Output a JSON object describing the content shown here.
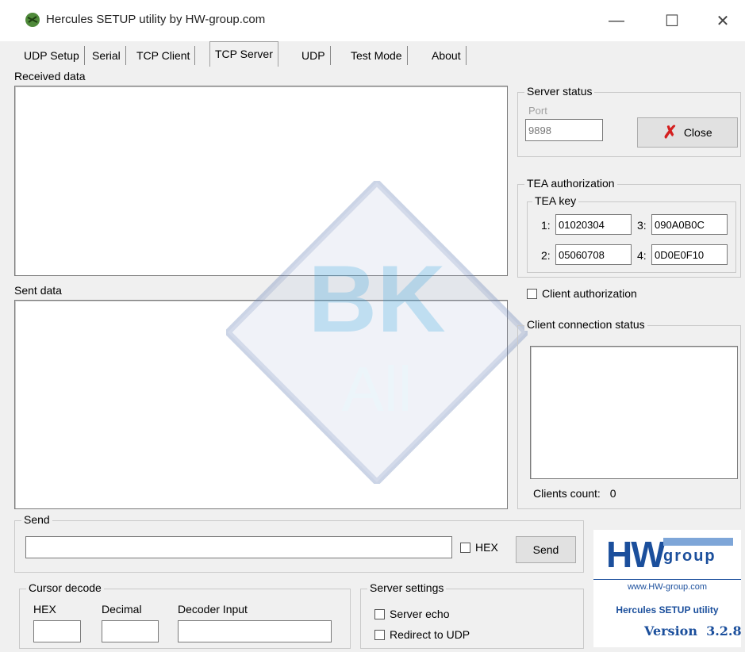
{
  "window": {
    "title": "Hercules SETUP utility by HW-group.com",
    "minimize": "—",
    "maximize": "☐",
    "close": "✕"
  },
  "tabs": [
    {
      "label": "UDP Setup"
    },
    {
      "label": "Serial"
    },
    {
      "label": "TCP Client"
    },
    {
      "label": "TCP Server",
      "active": true
    },
    {
      "label": "UDP"
    },
    {
      "label": "Test Mode"
    },
    {
      "label": "About"
    }
  ],
  "received": {
    "label": "Received data",
    "value": ""
  },
  "sent": {
    "label": "Sent data",
    "value": ""
  },
  "server_status": {
    "title": "Server status",
    "port_label": "Port",
    "port_value": "9898",
    "close_label": "Close"
  },
  "tea": {
    "title": "TEA authorization",
    "key_title": "TEA key",
    "keys": [
      {
        "num": "1:",
        "value": "01020304"
      },
      {
        "num": "3:",
        "value": "090A0B0C"
      },
      {
        "num": "2:",
        "value": "05060708"
      },
      {
        "num": "4:",
        "value": "0D0E0F10"
      }
    ],
    "client_auth_label": "Client authorization"
  },
  "client_conn": {
    "title": "Client connection status",
    "count_label": "Clients count:",
    "count_value": "0"
  },
  "send": {
    "title": "Send",
    "value": "",
    "hex_label": "HEX",
    "send_label": "Send"
  },
  "cursor_decode": {
    "title": "Cursor decode",
    "hex_label": "HEX",
    "decimal_label": "Decimal",
    "decoder_label": "Decoder Input"
  },
  "server_settings": {
    "title": "Server settings",
    "echo_label": "Server echo",
    "redirect_label": "Redirect to UDP"
  },
  "logo": {
    "brand_h": "H",
    "brand_w": "W",
    "brand_group": "group",
    "url": "www.HW-group.com",
    "product": "Hercules SETUP utility",
    "version": "Version  3.2.8"
  },
  "colors": {
    "logo_blue": "#1b4f9c",
    "close_x": "#d42020",
    "watermark": "#6d86b8"
  }
}
